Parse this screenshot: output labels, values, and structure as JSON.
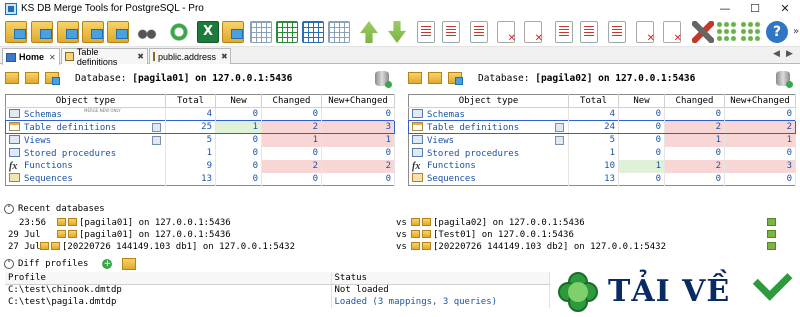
{
  "window": {
    "title": "KS DB Merge Tools for PostgreSQL - Pro"
  },
  "tabs": [
    {
      "label": "Home"
    },
    {
      "label": "Table definitions"
    },
    {
      "label": "public.address"
    }
  ],
  "left": {
    "db_label": "Database:",
    "db_value": "[pagila01] on 127.0.0.1:5436",
    "columns": [
      "Object type",
      "Total",
      "New",
      "Changed",
      "New+Changed"
    ],
    "rows": [
      {
        "name": "Schemas",
        "tag": "MERGE NEW ONLY",
        "total": "4",
        "new": "0",
        "changed": "0",
        "nc": "0"
      },
      {
        "name": "Table definitions",
        "total": "25",
        "new": "1",
        "changed": "2",
        "nc": "3"
      },
      {
        "name": "Views",
        "total": "5",
        "new": "0",
        "changed": "1",
        "nc": "1"
      },
      {
        "name": "Stored procedures",
        "total": "1",
        "new": "0",
        "changed": "0",
        "nc": "0"
      },
      {
        "name": "Functions",
        "total": "9",
        "new": "0",
        "changed": "2",
        "nc": "2"
      },
      {
        "name": "Sequences",
        "total": "13",
        "new": "0",
        "changed": "0",
        "nc": "0"
      }
    ]
  },
  "right": {
    "db_label": "Database:",
    "db_value": "[pagila02] on 127.0.0.1:5436",
    "columns": [
      "Object type",
      "Total",
      "New",
      "Changed",
      "New+Changed"
    ],
    "rows": [
      {
        "name": "Schemas",
        "tag": "",
        "total": "4",
        "new": "0",
        "changed": "0",
        "nc": "0"
      },
      {
        "name": "Table definitions",
        "total": "24",
        "new": "0",
        "changed": "2",
        "nc": "2"
      },
      {
        "name": "Views",
        "total": "5",
        "new": "0",
        "changed": "1",
        "nc": "1"
      },
      {
        "name": "Stored procedures",
        "total": "1",
        "new": "0",
        "changed": "0",
        "nc": "0"
      },
      {
        "name": "Functions",
        "total": "10",
        "new": "1",
        "changed": "2",
        "nc": "3"
      },
      {
        "name": "Sequences",
        "total": "13",
        "new": "0",
        "changed": "0",
        "nc": "0"
      }
    ]
  },
  "recent": {
    "title": "Recent databases",
    "vs": "vs",
    "items": [
      {
        "time": "23:56",
        "left": "[pagila01] on 127.0.0.1:5436",
        "right": "[pagila02] on 127.0.0.1:5436"
      },
      {
        "time": "29 Jul",
        "left": "[pagila01] on 127.0.0.1:5436",
        "right": "[Test01] on 127.0.0.1:5436"
      },
      {
        "time": "27 Jul",
        "left": "[20220726 144149.103 db1] on 127.0.0.1:5432",
        "right": "[20220726 144149.103 db2] on 127.0.0.1:5432"
      }
    ]
  },
  "profiles": {
    "title": "Diff profiles",
    "columns": [
      "Profile",
      "Status"
    ],
    "rows": [
      {
        "profile": "C:\\test\\chinook.dmtdp",
        "status": "Not loaded"
      },
      {
        "profile": "C:\\test\\pagila.dmtdp",
        "status": "Loaded (3 mappings, 3 queries)"
      }
    ]
  },
  "watermark": {
    "text": "TẢI VỀ"
  },
  "colors": {
    "accent": "#1a53a6",
    "new_bg": "#dff2d8",
    "changed_bg": "#f9d6d6",
    "selection": "#2f5fd0"
  }
}
